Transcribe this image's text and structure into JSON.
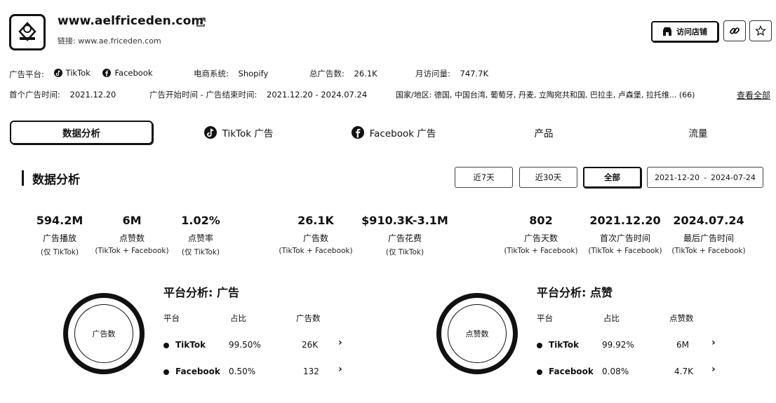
{
  "header": {
    "site": "www.aelfriceden.com",
    "link_label": "链接:",
    "link_url": "www.ae.friceden.com",
    "visit_store_label": "访问店铺",
    "icons": [
      "external-link-icon",
      "link-icon",
      "star-icon",
      "store-icon"
    ]
  },
  "meta": {
    "ad_platform_label": "广告平台:",
    "platforms": [
      "TikTok",
      "Facebook"
    ],
    "ecommerce_label": "电商系统:",
    "ecommerce_value": "Shopify",
    "total_ads_label": "总广告数:",
    "total_ads_value": "26.1K",
    "monthly_visits_label": "月访问量:",
    "monthly_visits_value": "747.7K",
    "first_ad_label": "首个广告时间:",
    "first_ad_value": "2021.12.20",
    "ad_period_label": "广告开始时间 - 广告结束时间:",
    "ad_period_value": "2021.12.20 - 2024.07.24",
    "regions_label": "国家/地区:",
    "regions_value": "德国, 中国台湾, 葡萄牙, 丹麦, 立陶宛共和国, 巴拉圭, 卢森堡, 拉托维... (66)",
    "view_all": "查看全部"
  },
  "tabs": [
    {
      "label": "数据分析",
      "active": true
    },
    {
      "label": "TikTok 广告"
    },
    {
      "label": "Facebook 广告"
    },
    {
      "label": "产品"
    },
    {
      "label": "流量"
    }
  ],
  "section": {
    "title": "数据分析",
    "ranges": [
      "近7天",
      "近30天",
      "全部"
    ],
    "active_range": "全部",
    "date_start": "2021-12-20",
    "date_sep": "-",
    "date_end": "2024-07-24"
  },
  "stats": [
    {
      "value": "594.2M",
      "label": "广告播放",
      "sub": "(仅 TikTok)"
    },
    {
      "value": "6M",
      "label": "点赞数",
      "sub": "(TikTok + Facebook)"
    },
    {
      "value": "1.02%",
      "label": "点赞率",
      "sub": "(仅 TikTok)"
    },
    {
      "value": "26.1K",
      "label": "广告数",
      "sub": "(TikTok + Facebook)"
    },
    {
      "value": "$910.3K-3.1M",
      "label": "广告花费",
      "sub": "(仅 TikTok)"
    },
    {
      "value": "802",
      "label": "广告天数",
      "sub": "(TikTok + Facebook)"
    },
    {
      "value": "2021.12.20",
      "label": "首次广告时间",
      "sub": "(TikTok + Facebook)"
    },
    {
      "value": "2024.07.24",
      "label": "最后广告时间",
      "sub": "(TikTok + Facebook)"
    }
  ],
  "analysis_ads": {
    "title": "平台分析: 广告",
    "donut_label": "广告数",
    "headers": [
      "平台",
      "占比",
      "广告数"
    ],
    "rows": [
      {
        "platform": "TikTok",
        "share": "99.50%",
        "count": "26K"
      },
      {
        "platform": "Facebook",
        "share": "0.50%",
        "count": "132"
      }
    ]
  },
  "analysis_likes": {
    "title": "平台分析: 点赞",
    "donut_label": "点赞数",
    "headers": [
      "平台",
      "占比",
      "点赞数"
    ],
    "rows": [
      {
        "platform": "TikTok",
        "share": "99.92%",
        "count": "6M"
      },
      {
        "platform": "Facebook",
        "share": "0.08%",
        "count": "4.7K"
      }
    ]
  },
  "chevron": "›"
}
